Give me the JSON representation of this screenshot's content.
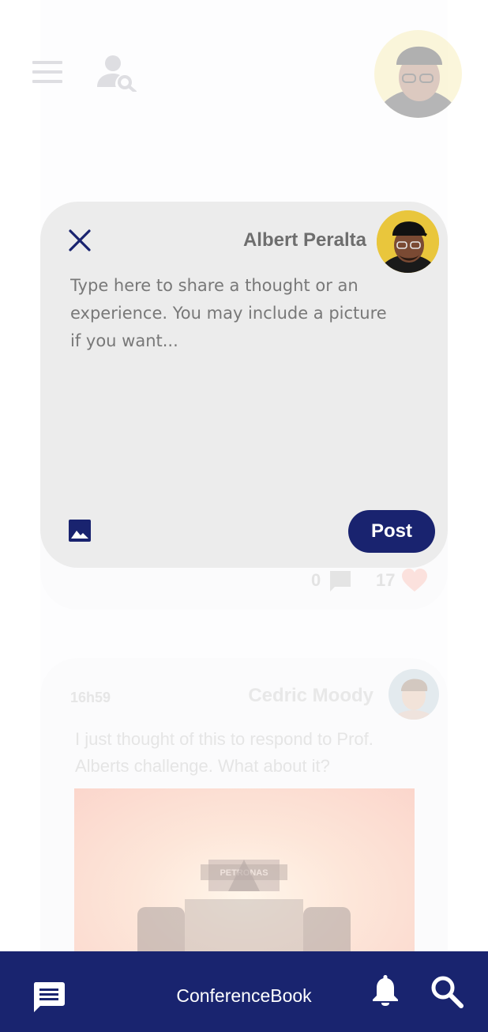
{
  "app": {
    "title": "ConferenceBook"
  },
  "colors": {
    "primary": "#19236f",
    "modal_bg": "#ececec",
    "muted_text": "#6e6e6e"
  },
  "icons": {
    "menu": "hamburger-icon",
    "people_search": "person-search-icon",
    "close": "close-icon",
    "image": "image-icon",
    "chat": "chat-icon",
    "notifications": "bell-icon",
    "search": "search-icon"
  },
  "compose": {
    "author_name": "Albert Peralta",
    "placeholder": "Type here to share a thought or an experience. You may include a picture if you want...",
    "post_label": "Post"
  },
  "feed": {
    "post1": {
      "comment_count": "0",
      "like_count": "17"
    },
    "post2": {
      "time": "16h59",
      "author": "Cedric Moody",
      "text": "I just thought of this to respond to Prof. Alberts challenge. What about it?",
      "image_text": "PETRONAS"
    }
  }
}
